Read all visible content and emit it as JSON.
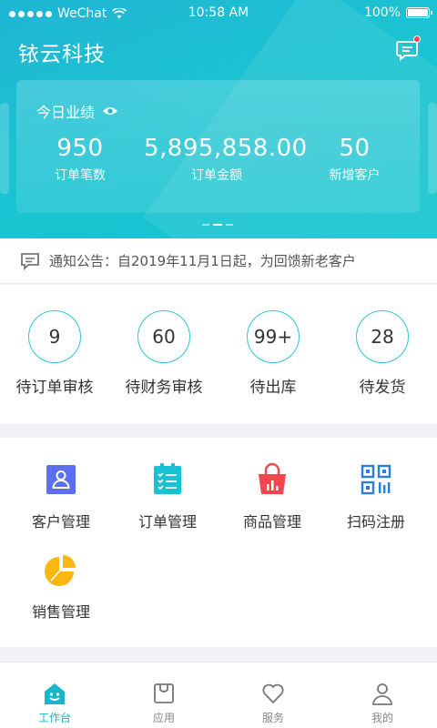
{
  "status_bar": {
    "carrier": "WeChat",
    "time": "10:58 AM",
    "battery": "100%"
  },
  "header": {
    "company": "铱云科技"
  },
  "performance": {
    "title": "今日业绩",
    "stats": [
      {
        "value": "950",
        "label": "订单笔数"
      },
      {
        "value": "5,895,858.00",
        "label": "订单金额"
      },
      {
        "value": "50",
        "label": "新增客户"
      }
    ]
  },
  "notice": {
    "text": "通知公告：自2019年11月1日起，为回馈新老客户"
  },
  "pending": [
    {
      "count": "9",
      "label": "待订单审核"
    },
    {
      "count": "60",
      "label": "待财务审核"
    },
    {
      "count": "99+",
      "label": "待出库"
    },
    {
      "count": "28",
      "label": "待发货"
    }
  ],
  "grid": [
    {
      "label": "客户管理",
      "icon": "customer-icon"
    },
    {
      "label": "订单管理",
      "icon": "order-icon"
    },
    {
      "label": "商品管理",
      "icon": "product-bag-icon"
    },
    {
      "label": "扫码注册",
      "icon": "qr-code-icon"
    },
    {
      "label": "销售管理",
      "icon": "pie-chart-icon"
    }
  ],
  "tabs": [
    {
      "label": "工作台",
      "icon": "workbench-icon",
      "active": true
    },
    {
      "label": "应用",
      "icon": "app-box-icon",
      "active": false
    },
    {
      "label": "服务",
      "icon": "heart-icon",
      "active": false
    },
    {
      "label": "我的",
      "icon": "user-icon",
      "active": false
    }
  ],
  "colors": {
    "accent": "#18b7c8",
    "header_gradient": "#1fb6d4",
    "badge": "#f2474f"
  }
}
